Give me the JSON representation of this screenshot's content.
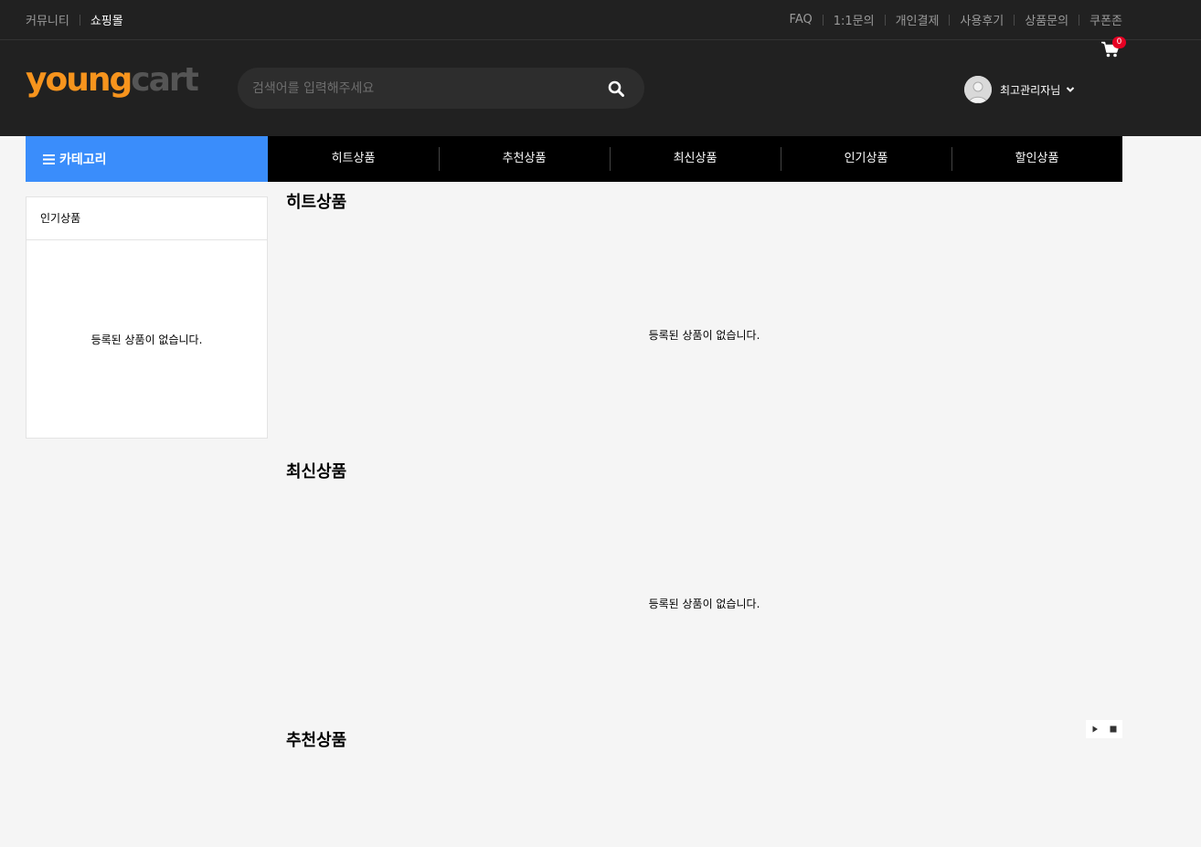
{
  "topbar": {
    "left": [
      {
        "label": "커뮤니티",
        "active": false
      },
      {
        "label": "쇼핑몰",
        "active": true
      }
    ],
    "right": [
      "FAQ",
      "1:1문의",
      "개인결제",
      "사용후기",
      "상품문의",
      "쿠폰존"
    ]
  },
  "header": {
    "logo_part1": "young",
    "logo_part2": "cart",
    "search_placeholder": "검색어를 입력해주세요",
    "username": "최고관리자님",
    "cart_count": "0"
  },
  "nav": {
    "category_label": "카테고리",
    "items": [
      "히트상품",
      "추천상품",
      "최신상품",
      "인기상품",
      "할인상품"
    ]
  },
  "sidebar": {
    "title": "인기상품",
    "empty_text": "등록된 상품이 없습니다."
  },
  "sections": [
    {
      "title": "히트상품",
      "empty_text": "등록된 상품이 없습니다."
    },
    {
      "title": "최신상품",
      "empty_text": "등록된 상품이 없습니다."
    },
    {
      "title": "추천상품"
    }
  ],
  "colors": {
    "accent": "#3a8dfb",
    "logo_orange": "#f7941d",
    "badge": "#e60023",
    "dark_bg": "#212121"
  }
}
